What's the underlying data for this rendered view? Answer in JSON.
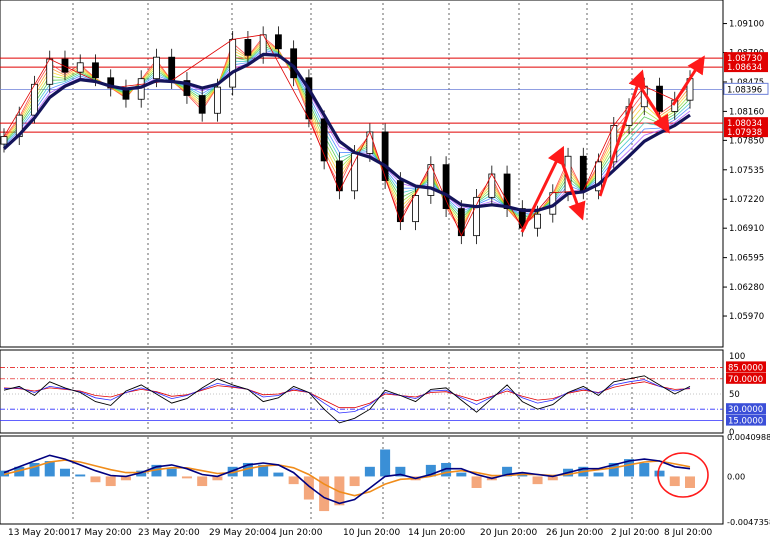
{
  "colors": {
    "background": "#ffffff",
    "grid": "#000000",
    "candle": "#000000",
    "ma_thick": "#14145a",
    "level_line": "#e00000",
    "current_price_line": "#6b7fd8",
    "arrow": "#ff1a1a",
    "rsi_black": "#000000",
    "rsi_blue": "#2d2dff",
    "rsi_red": "#e00000",
    "macd_pos": "#3a8fd6",
    "macd_neg": "#f4a77c",
    "macd_line": "#000080",
    "signal_line": "#f08c1a",
    "tag_red": "#e00000",
    "tag_blue": "#3b4fd8"
  },
  "chart_data": [
    {
      "type": "candlestick",
      "panel": "price",
      "x_ticks": [
        "13 May 20:00",
        "17 May 20:00",
        "23 May 20:00",
        "29 May 20:00",
        "4 Jun 20:00",
        "10 Jun 20:00",
        "14 Jun 20:00",
        "20 Jun 20:00",
        "26 Jun 20:00",
        "2 Jul 20:00",
        "8 Jul 20:00"
      ],
      "y_ticks": [
        "1.09100",
        "1.08790",
        "1.08475",
        "1.08160",
        "1.07850",
        "1.07535",
        "1.07220",
        "1.06910",
        "1.06595",
        "1.06280",
        "1.05970"
      ],
      "ylim": [
        1.0566,
        1.0932
      ],
      "close_series": [
        1.0789,
        1.0812,
        1.0845,
        1.0872,
        1.0858,
        1.0868,
        1.0852,
        1.0841,
        1.0829,
        1.0851,
        1.0874,
        1.0849,
        1.0833,
        1.0814,
        1.0842,
        1.0893,
        1.0876,
        1.0898,
        1.0883,
        1.0852,
        1.0808,
        1.0763,
        1.0731,
        1.0771,
        1.0794,
        1.0742,
        1.0698,
        1.0726,
        1.0759,
        1.0712,
        1.0683,
        1.0724,
        1.0749,
        1.0712,
        1.0691,
        1.0706,
        1.0729,
        1.0768,
        1.0731,
        1.0762,
        1.0801,
        1.0821,
        1.0843,
        1.0816,
        1.0828,
        1.0851
      ],
      "ma_series": [
        1.0776,
        1.0791,
        1.0809,
        1.0831,
        1.0843,
        1.085,
        1.0848,
        1.0843,
        1.084,
        1.0842,
        1.0849,
        1.0848,
        1.0846,
        1.0841,
        1.0845,
        1.0858,
        1.0866,
        1.0877,
        1.0876,
        1.0864,
        1.084,
        1.0812,
        1.0784,
        1.0772,
        1.0767,
        1.0758,
        1.0744,
        1.0736,
        1.0734,
        1.0727,
        1.0716,
        1.0714,
        1.0716,
        1.0714,
        1.071,
        1.071,
        1.0715,
        1.0728,
        1.073,
        1.0738,
        1.0753,
        1.0768,
        1.0784,
        1.0793,
        1.0801,
        1.0812
      ],
      "levels": [
        {
          "label": "1.08730",
          "price": 1.0873,
          "style": "solid"
        },
        {
          "label": "1.08634",
          "price": 1.08634,
          "style": "solid"
        },
        {
          "label": "1.08034",
          "price": 1.08034,
          "style": "solid"
        },
        {
          "label": "1.07938",
          "price": 1.07938,
          "style": "solid"
        }
      ],
      "current_price": {
        "label": "1.08396",
        "price": 1.08396
      }
    },
    {
      "type": "line",
      "panel": "rsi",
      "y_ticks": [
        "100",
        "85.0000",
        "70.0000",
        "50",
        "30.0000",
        "15.0000",
        "0"
      ],
      "ylim": [
        0,
        100
      ],
      "levels": [
        85,
        70,
        50,
        30,
        15
      ],
      "series_black": [
        55,
        60,
        48,
        66,
        58,
        52,
        40,
        35,
        54,
        62,
        50,
        38,
        44,
        58,
        70,
        62,
        56,
        40,
        45,
        60,
        52,
        30,
        12,
        18,
        30,
        55,
        48,
        40,
        56,
        58,
        42,
        26,
        44,
        62,
        40,
        30,
        36,
        52,
        60,
        48,
        66,
        70,
        74,
        62,
        50,
        60
      ],
      "series_blue": [
        57,
        58,
        52,
        60,
        57,
        53,
        45,
        42,
        52,
        58,
        52,
        44,
        48,
        56,
        64,
        60,
        56,
        46,
        48,
        57,
        52,
        38,
        25,
        27,
        36,
        52,
        48,
        44,
        54,
        55,
        45,
        36,
        46,
        57,
        45,
        38,
        42,
        52,
        57,
        51,
        62,
        66,
        69,
        60,
        54,
        58
      ],
      "series_red": [
        58,
        57,
        54,
        58,
        56,
        54,
        48,
        46,
        52,
        56,
        53,
        47,
        49,
        55,
        61,
        59,
        56,
        49,
        50,
        55,
        52,
        42,
        32,
        32,
        38,
        50,
        48,
        46,
        52,
        53,
        47,
        41,
        47,
        54,
        47,
        42,
        44,
        51,
        55,
        52,
        59,
        63,
        66,
        60,
        56,
        57
      ]
    },
    {
      "type": "bar",
      "panel": "macd",
      "y_ticks": [
        "0.0040988",
        "0.00",
        "-0.0047358"
      ],
      "ylim": [
        -0.0047358,
        0.0040988
      ],
      "histogram": [
        0.0006,
        0.001,
        0.0014,
        0.0016,
        0.0008,
        0.0002,
        -0.0006,
        -0.001,
        -0.0004,
        0.0006,
        0.0012,
        0.0008,
        -0.0002,
        -0.001,
        -0.0004,
        0.001,
        0.0014,
        0.0012,
        0.0004,
        -0.0008,
        -0.0024,
        -0.0036,
        -0.003,
        -0.001,
        0.001,
        0.0028,
        0.001,
        -0.0004,
        0.0012,
        0.0014,
        0.0004,
        -0.0012,
        -0.0004,
        0.001,
        0.0004,
        -0.0008,
        -0.0004,
        0.0008,
        0.001,
        0.0004,
        0.0014,
        0.0018,
        0.0014,
        0.0006,
        -0.001,
        -0.0012
      ],
      "macd_series": [
        0.0004,
        0.001,
        0.0016,
        0.0022,
        0.0018,
        0.0012,
        0.0006,
        0.0001,
        0.0,
        0.0004,
        0.001,
        0.0012,
        0.0008,
        0.0002,
        0.0,
        0.0006,
        0.0012,
        0.0014,
        0.0012,
        0.0004,
        -0.001,
        -0.0022,
        -0.0028,
        -0.0024,
        -0.0012,
        0.0,
        0.0002,
        -0.0002,
        0.0002,
        0.0008,
        0.0008,
        0.0002,
        -0.0002,
        0.0002,
        0.0004,
        0.0002,
        0.0,
        0.0004,
        0.0008,
        0.0008,
        0.0012,
        0.0016,
        0.0018,
        0.0016,
        0.001,
        0.0008
      ],
      "signal_series": [
        0.0002,
        0.0006,
        0.001,
        0.0015,
        0.0017,
        0.0015,
        0.0011,
        0.0007,
        0.0004,
        0.0004,
        0.0007,
        0.0009,
        0.0009,
        0.0006,
        0.0003,
        0.0004,
        0.0008,
        0.0011,
        0.0012,
        0.0009,
        0.0002,
        -0.0008,
        -0.0016,
        -0.002,
        -0.0016,
        -0.0008,
        -0.0003,
        -0.0002,
        0.0,
        0.0004,
        0.0006,
        0.0004,
        0.0001,
        0.0001,
        0.0002,
        0.0002,
        0.0001,
        0.0002,
        0.0005,
        0.0007,
        0.0009,
        0.0012,
        0.0015,
        0.0016,
        0.0013,
        0.001
      ]
    }
  ]
}
